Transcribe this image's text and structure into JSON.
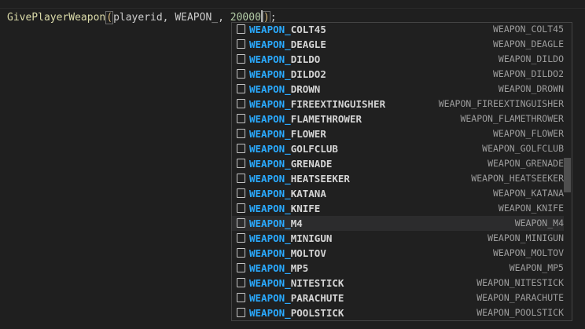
{
  "editor": {
    "fn": "GivePlayerWeapon",
    "open_paren": "(",
    "args": "playerid, WEAPON_, ",
    "number": "20000",
    "close_paren": ")",
    "semicolon": ";"
  },
  "suggest": {
    "match_prefix": "WEAPON_",
    "selected_index": 13,
    "items": [
      {
        "rest": "COLT45",
        "detail": "WEAPON_COLT45"
      },
      {
        "rest": "DEAGLE",
        "detail": "WEAPON_DEAGLE"
      },
      {
        "rest": "DILDO",
        "detail": "WEAPON_DILDO"
      },
      {
        "rest": "DILDO2",
        "detail": "WEAPON_DILDO2"
      },
      {
        "rest": "DROWN",
        "detail": "WEAPON_DROWN"
      },
      {
        "rest": "FIREEXTINGUISHER",
        "detail": "WEAPON_FIREEXTINGUISHER"
      },
      {
        "rest": "FLAMETHROWER",
        "detail": "WEAPON_FLAMETHROWER"
      },
      {
        "rest": "FLOWER",
        "detail": "WEAPON_FLOWER"
      },
      {
        "rest": "GOLFCLUB",
        "detail": "WEAPON_GOLFCLUB"
      },
      {
        "rest": "GRENADE",
        "detail": "WEAPON_GRENADE"
      },
      {
        "rest": "HEATSEEKER",
        "detail": "WEAPON_HEATSEEKER"
      },
      {
        "rest": "KATANA",
        "detail": "WEAPON_KATANA"
      },
      {
        "rest": "KNIFE",
        "detail": "WEAPON_KNIFE"
      },
      {
        "rest": "M4",
        "detail": "WEAPON_M4"
      },
      {
        "rest": "MINIGUN",
        "detail": "WEAPON_MINIGUN"
      },
      {
        "rest": "MOLTOV",
        "detail": "WEAPON_MOLTOV"
      },
      {
        "rest": "MP5",
        "detail": "WEAPON_MP5"
      },
      {
        "rest": "NITESTICK",
        "detail": "WEAPON_NITESTICK"
      },
      {
        "rest": "PARACHUTE",
        "detail": "WEAPON_PARACHUTE"
      },
      {
        "rest": "POOLSTICK",
        "detail": "WEAPON_POOLSTICK"
      }
    ],
    "icon": "constant-icon"
  },
  "colors": {
    "match": "#2aaaff",
    "background": "#1f1f1f",
    "selected_row": "#2c2c2d"
  }
}
